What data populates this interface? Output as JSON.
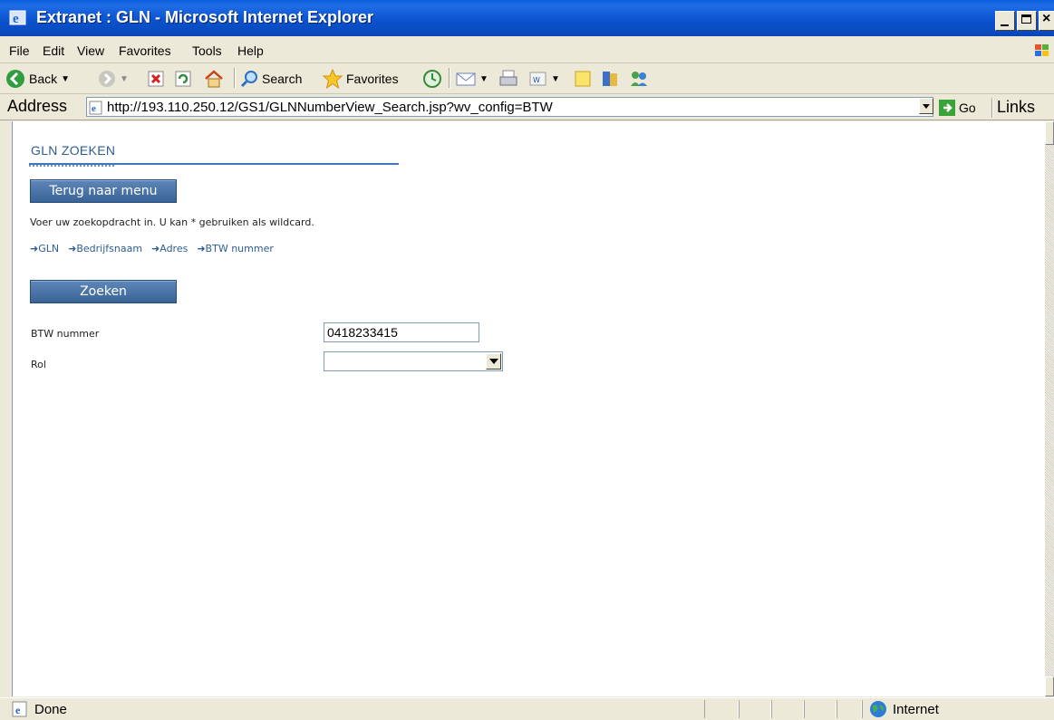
{
  "window": {
    "title": "Extranet : GLN - Microsoft Internet Explorer"
  },
  "menu": {
    "items": [
      "File",
      "Edit",
      "View",
      "Favorites",
      "Tools",
      "Help"
    ]
  },
  "toolbar": {
    "back_label": "Back",
    "search_label": "Search",
    "favorites_label": "Favorites"
  },
  "address": {
    "label": "Address",
    "url": "http://193.110.250.12/GS1/GLNNumberView_Search.jsp?wv_config=BTW",
    "go_label": "Go",
    "links_label": "Links"
  },
  "page": {
    "title": "GLN ZOEKEN",
    "back_button": "Terug naar menu",
    "instruction": "Voer uw zoekopdracht in. U kan * gebruiken als wildcard.",
    "tabs": [
      "➜GLN",
      "➜Bedrijfsnaam",
      "➜Adres",
      "➜BTW nummer"
    ],
    "search_button": "Zoeken",
    "btw_label": "BTW nummer",
    "btw_value": "0418233415",
    "rol_label": "Rol",
    "rol_value": ""
  },
  "status": {
    "text": "Done",
    "zone": "Internet"
  },
  "colors": {
    "titlebar": "#0a5fdc",
    "link_blue": "#2d5d92",
    "button_blue": "#3a6496"
  }
}
